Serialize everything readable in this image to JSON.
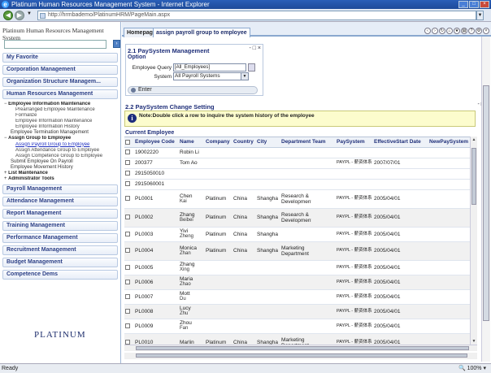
{
  "window": {
    "title": "Platinum Human Resources Management System - Internet Explorer",
    "url": "http://hrmbademo/PlatinumHRM/PageMain.aspx"
  },
  "sidebar": {
    "system_title": "Platinum Human Resources Management System",
    "search_placeholder": "",
    "menus": [
      {
        "label": "My Favorite"
      },
      {
        "label": "Corporation Management"
      },
      {
        "label": "Organization Structure Managem..."
      },
      {
        "label": "Human Resources Management"
      }
    ],
    "hr_submenu": {
      "group1": "Employee Information Maintenance",
      "group1_items": [
        "Prearranged Employee Maintenance",
        "Formalize",
        "Employee Information Maintenance",
        "Employee Information History"
      ],
      "termination": "Employee Termination Management",
      "group2": "Assign Group to Employee",
      "group2_items": [
        "Assign Payroll Group to Employee",
        "Assign Attendance Group to Employee",
        "Assign Competence Group to Employee"
      ],
      "submit_payroll": "Submit Employee On Payroll",
      "movement_history": "Employee Movement History",
      "list_maintenance": "List Maintenance",
      "admin_tools": "Administrator Tools"
    },
    "menus_bottom": [
      {
        "label": "Payroll Management"
      },
      {
        "label": "Attendance Management"
      },
      {
        "label": "Report Management"
      },
      {
        "label": "Training Management"
      },
      {
        "label": "Performance Management"
      },
      {
        "label": "Recruitment Management"
      },
      {
        "label": "Budget Management"
      },
      {
        "label": "Competence Dems"
      }
    ],
    "logo_text": "PLATINUM"
  },
  "tabs": [
    {
      "label": "Homepage"
    },
    {
      "label": "assign payroll group to employee"
    }
  ],
  "panel1": {
    "title": "2.1 PaySystem Management",
    "subtitle": "Option",
    "employee_query_label": "Employee Query",
    "employee_query_value": "[All_Employees]",
    "system_label": "System",
    "system_value": "All Payroll Systems",
    "enter_label": "Enter"
  },
  "panel2": {
    "title": "2.2 PaySystem Change Setting",
    "note": "Note:Double click a row to inquire the system history of the employee",
    "current_employee": "Current Employee"
  },
  "grid": {
    "columns": [
      "Employee Code",
      "Name",
      "Company",
      "Country",
      "City",
      "Department",
      "Team",
      "PaySystem",
      "EffectiveStart Date",
      "NewPaySystem"
    ],
    "rows": [
      {
        "code": "19002220",
        "name": "Robin Li",
        "name2": "",
        "company": "",
        "country": "",
        "city": "",
        "dept": "",
        "team": "",
        "pay": "",
        "date": ""
      },
      {
        "code": "200377",
        "name": "Tom Ao",
        "name2": "",
        "company": "",
        "country": "",
        "city": "",
        "dept": "",
        "team": "",
        "pay": "PAYPL - 薪资体系",
        "date": "2007/07/01"
      },
      {
        "code": "2915050010",
        "name": "",
        "name2": "",
        "company": "",
        "country": "",
        "city": "",
        "dept": "",
        "team": "",
        "pay": "",
        "date": ""
      },
      {
        "code": "2915060001",
        "name": "",
        "name2": "",
        "company": "",
        "country": "",
        "city": "",
        "dept": "",
        "team": "",
        "pay": "",
        "date": ""
      },
      {
        "code": "PL0001",
        "name": "Chen",
        "name2": "Kai",
        "company": "Platinum",
        "country": "China",
        "city": "Shangha",
        "dept": "Research & Development",
        "team": "",
        "pay": "PAYPL - 薪资体系",
        "date": "2005/04/01"
      },
      {
        "code": "PL0002",
        "name": "Zhang",
        "name2": "Beibei",
        "company": "Platinum",
        "country": "China",
        "city": "Shangha",
        "dept": "Research & Development",
        "team": "",
        "pay": "PAYPL - 薪资体系",
        "date": "2005/04/01"
      },
      {
        "code": "PL0003",
        "name": "Yivi",
        "name2": "Zheng",
        "company": "Platinum",
        "country": "China",
        "city": "Shangha",
        "dept": "",
        "team": "",
        "pay": "PAYPL - 薪资体系",
        "date": "2005/04/01"
      },
      {
        "code": "PL0004",
        "name": "Monica",
        "name2": "Zhan",
        "company": "Platinum",
        "country": "China",
        "city": "Shangha",
        "dept": "Marketing Department",
        "team": "",
        "pay": "PAYPL - 薪资体系",
        "date": "2005/04/01"
      },
      {
        "code": "PL0005",
        "name": "Zhang",
        "name2": "Xing",
        "company": "",
        "country": "",
        "city": "",
        "dept": "",
        "team": "",
        "pay": "PAYPL - 薪资体系",
        "date": "2005/04/01"
      },
      {
        "code": "PL0006",
        "name": "Maria",
        "name2": "Zhao",
        "company": "",
        "country": "",
        "city": "",
        "dept": "",
        "team": "",
        "pay": "PAYPL - 薪资体系",
        "date": "2005/04/01"
      },
      {
        "code": "PL0007",
        "name": "Mott",
        "name2": "Du",
        "company": "",
        "country": "",
        "city": "",
        "dept": "",
        "team": "",
        "pay": "PAYPL - 薪资体系",
        "date": "2005/04/01"
      },
      {
        "code": "PL0008",
        "name": "Lucy",
        "name2": "Zhu",
        "company": "",
        "country": "",
        "city": "",
        "dept": "",
        "team": "",
        "pay": "PAYPL - 薪资体系",
        "date": "2005/04/01"
      },
      {
        "code": "PL0009",
        "name": "Zhou",
        "name2": "Fan",
        "company": "",
        "country": "",
        "city": "",
        "dept": "",
        "team": "",
        "pay": "PAYPL - 薪资体系",
        "date": "2005/04/01"
      },
      {
        "code": "PL0010",
        "name": "Marlin",
        "name2": "",
        "company": "Platinum",
        "country": "China",
        "city": "Shangha",
        "dept": "Marketing Department",
        "team": "",
        "pay": "PAYPL - 薪资体系",
        "date": "2005/04/01"
      }
    ]
  },
  "status": {
    "left": "Ready",
    "zoom": "100%"
  }
}
